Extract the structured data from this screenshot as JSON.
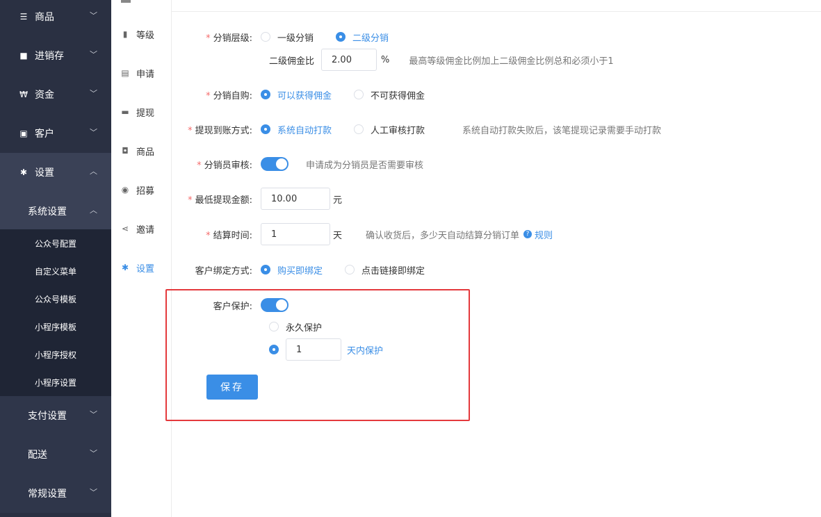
{
  "sidebar": {
    "items": [
      {
        "label": "商品",
        "icon": "menu-icon"
      },
      {
        "label": "进销存",
        "icon": "truck-icon"
      },
      {
        "label": "资金",
        "icon": "won-icon"
      },
      {
        "label": "客户",
        "icon": "id-card-icon"
      },
      {
        "label": "设置",
        "icon": "gear-icon"
      }
    ],
    "system_settings": "系统设置",
    "leaves": [
      "公众号配置",
      "自定义菜单",
      "公众号模板",
      "小程序模板",
      "小程序授权",
      "小程序设置"
    ],
    "pay_settings": "支付设置",
    "delivery": "配送",
    "general_settings": "常规设置"
  },
  "submenu": {
    "items": [
      {
        "label": "等级",
        "icon": "bar-chart-icon"
      },
      {
        "label": "申请",
        "icon": "clipboard-icon"
      },
      {
        "label": "提现",
        "icon": "wallet-icon"
      },
      {
        "label": "商品",
        "icon": "bag-icon"
      },
      {
        "label": "招募",
        "icon": "target-icon"
      },
      {
        "label": "邀请",
        "icon": "share-icon"
      },
      {
        "label": "设置",
        "icon": "gear-icon"
      }
    ]
  },
  "form": {
    "required_mark": "*",
    "level": {
      "label": "分销层级:",
      "option1": "一级分销",
      "option2": "二级分销",
      "ratio_label": "二级佣金比",
      "ratio_value": "2.00",
      "ratio_unit": "%",
      "ratio_hint": "最高等级佣金比例加上二级佣金比例总和必须小于1"
    },
    "self_buy": {
      "label": "分销自购:",
      "option1": "可以获得佣金",
      "option2": "不可获得佣金"
    },
    "withdraw": {
      "label": "提现到账方式:",
      "option1": "系统自动打款",
      "option2": "人工审核打款",
      "hint": "系统自动打款失败后，该笔提现记录需要手动打款"
    },
    "audit": {
      "label": "分销员审核:",
      "hint": "申请成为分销员是否需要审核"
    },
    "min_withdraw": {
      "label": "最低提现金额:",
      "value": "10.00",
      "unit": "元"
    },
    "settle": {
      "label": "结算时间:",
      "value": "1",
      "unit": "天",
      "hint": "确认收货后，多少天自动结算分销订单",
      "help_icon": "?",
      "help_link": "规则"
    },
    "bind": {
      "label": "客户绑定方式:",
      "option1": "购买即绑定",
      "option2": "点击链接即绑定"
    },
    "protect": {
      "label": "客户保护:",
      "option1": "永久保护",
      "days_value": "1",
      "days_label": "天内保护"
    },
    "save": "保存"
  },
  "colors": {
    "accent": "#3a8ee6",
    "sidebar_bg": "#2a3042",
    "highlight_border": "#e4393c",
    "required": "#f56c6c"
  }
}
